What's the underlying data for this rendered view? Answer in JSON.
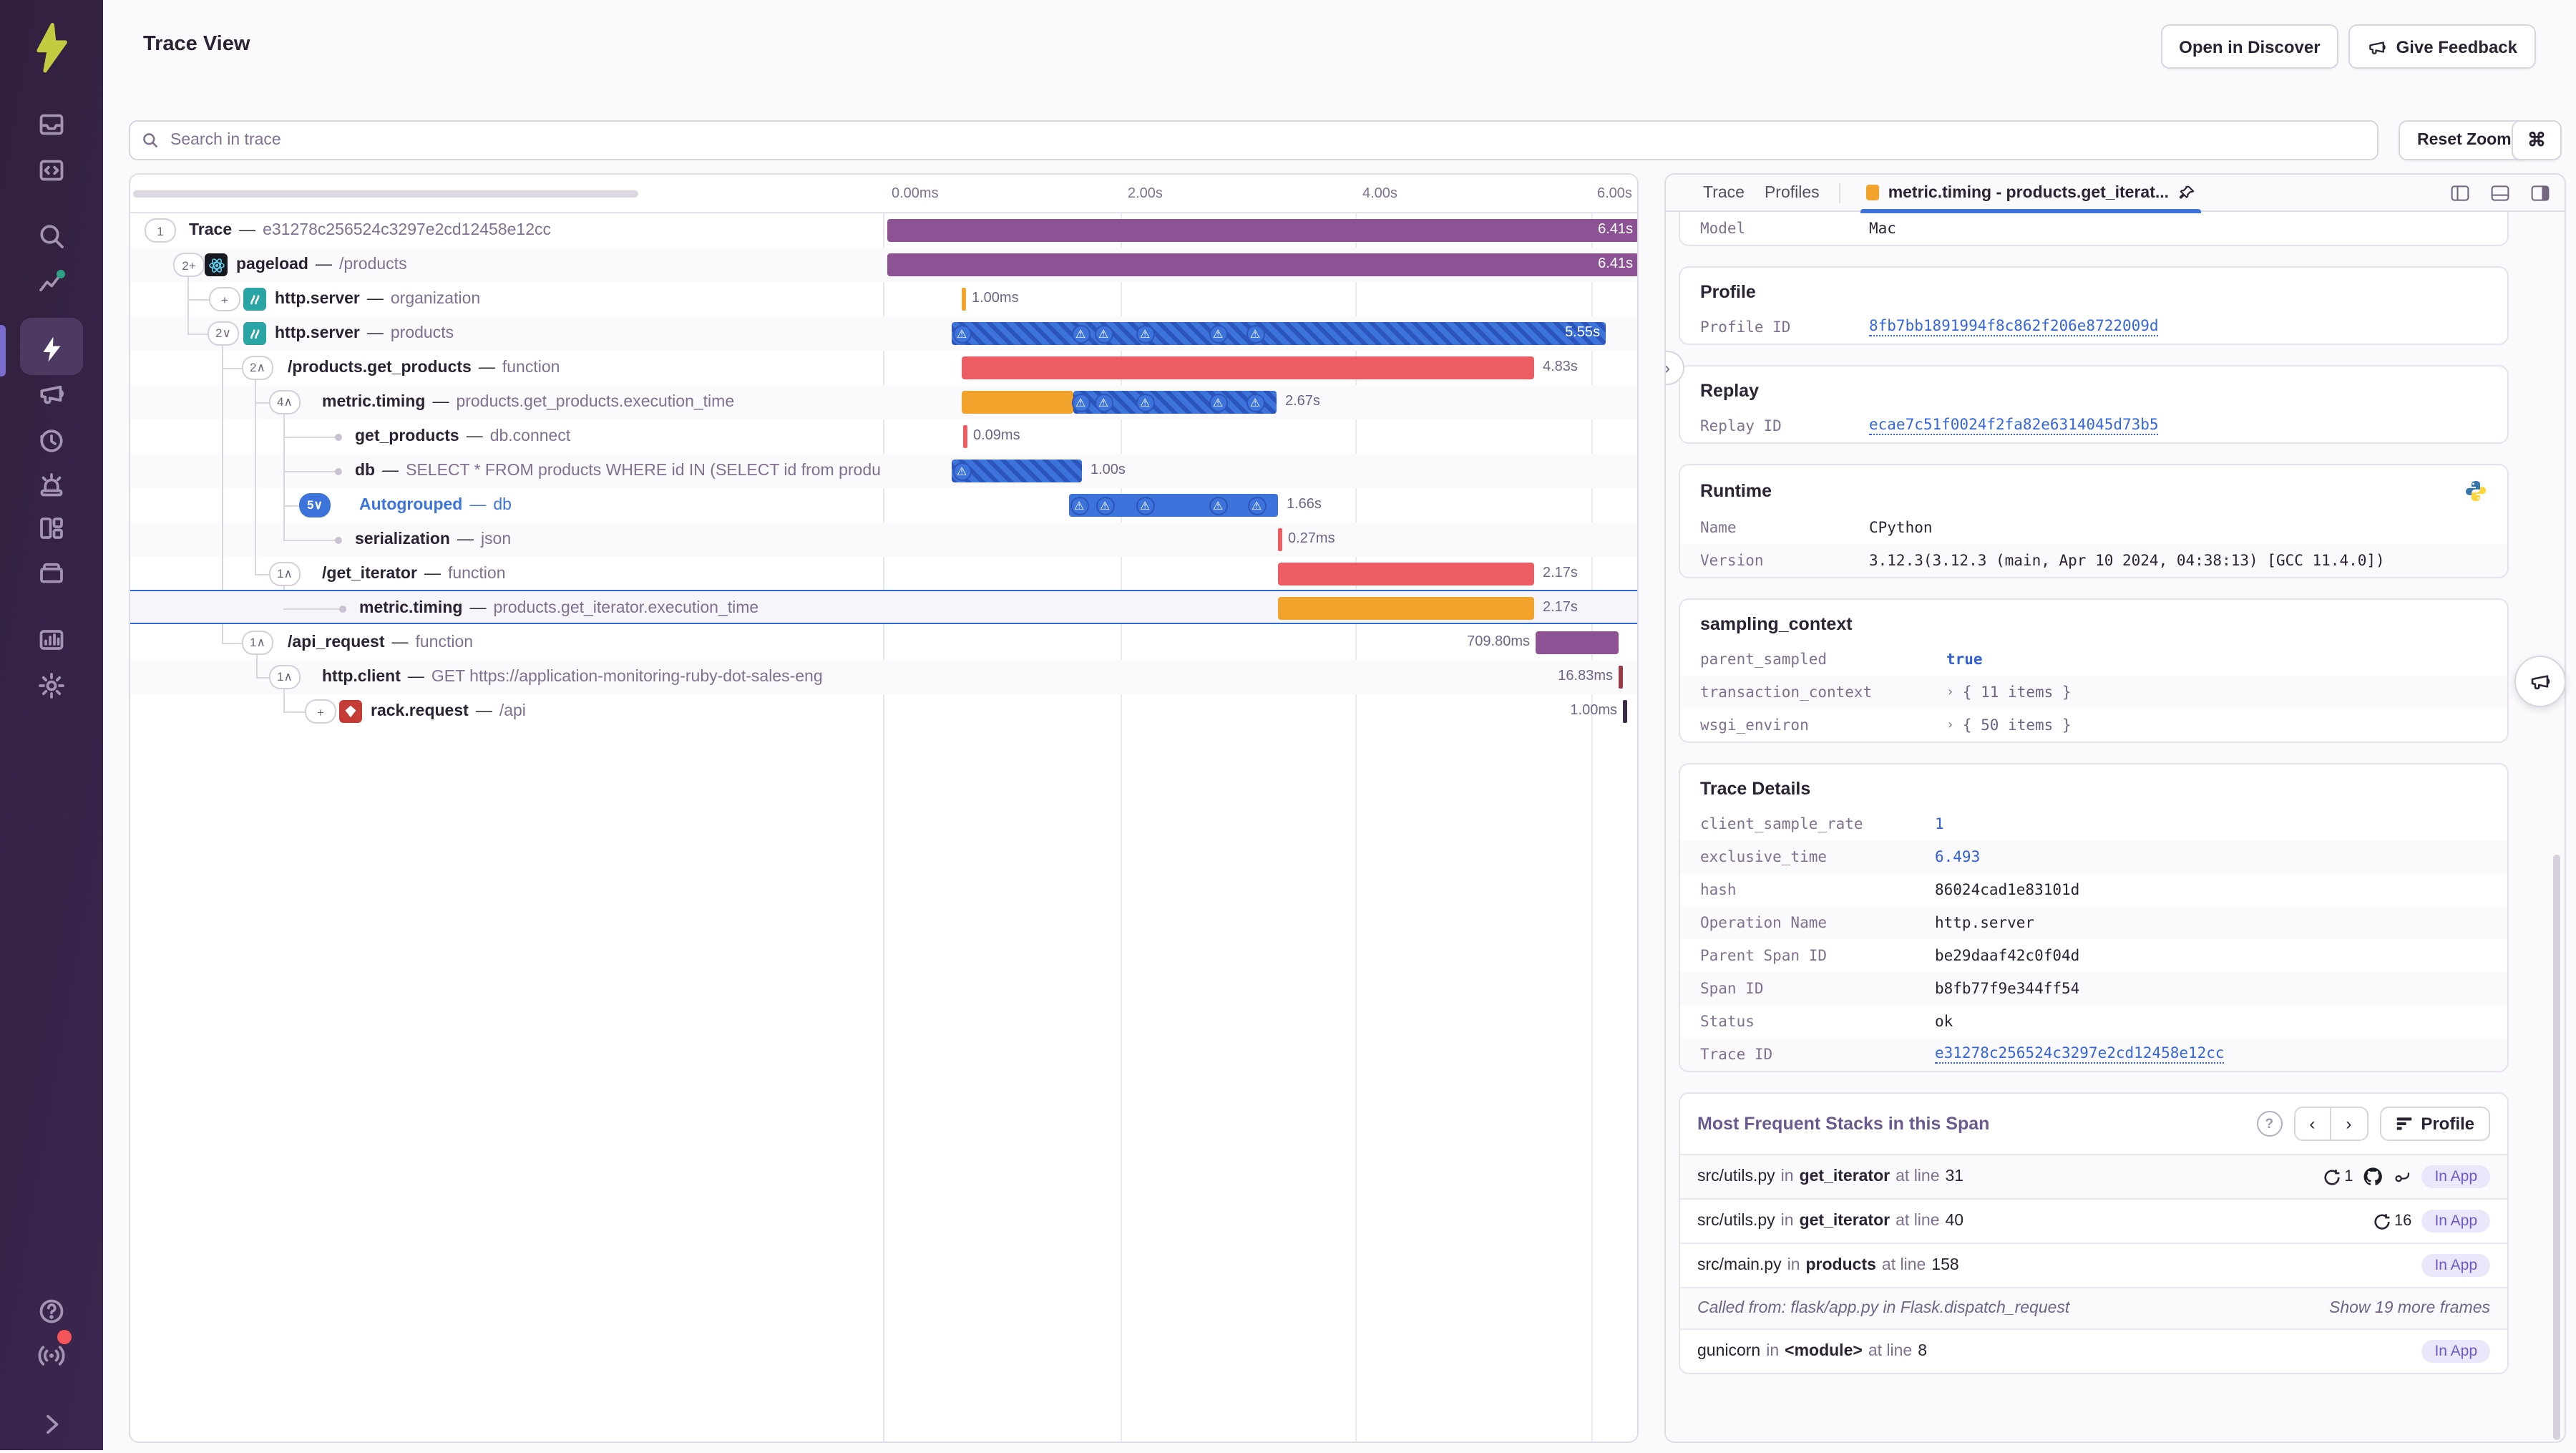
{
  "header": {
    "title": "Trace View",
    "open_in_discover": "Open in Discover",
    "give_feedback": "Give Feedback"
  },
  "toolbar": {
    "search_placeholder": "Search in trace",
    "reset_zoom": "Reset Zoom",
    "shortcut": "⌘"
  },
  "sidebar": {
    "items": [
      "issues-icon",
      "projects-icon",
      "search-icon",
      "performance-icon",
      "trace-icon",
      "megaphone-icon",
      "replays-icon",
      "alerts-icon",
      "dashboards-icon",
      "archive-icon",
      "stats-icon",
      "settings-icon"
    ],
    "active_item": "trace-icon",
    "bottom_items": [
      "help-icon",
      "whats-new-icon",
      "collapse-sidebar-icon"
    ]
  },
  "timeline": {
    "ticks": [
      "0.00ms",
      "2.00s",
      "4.00s",
      "6.00s"
    ]
  },
  "trace_tree": {
    "rows": [
      {
        "pill": "1",
        "title": "Trace",
        "desc": "e31278c256524c3297e2cd12458e12cc",
        "duration": "6.41s",
        "color": "purple"
      },
      {
        "pill": "2+",
        "icon": "react-icon",
        "title": "pageload",
        "desc": "/products",
        "duration": "6.41s",
        "color": "purple",
        "shade": true
      },
      {
        "pill": "+",
        "icon": "flask-icon",
        "title": "http.server",
        "desc": "organization",
        "duration": "1.00ms",
        "color": "orange"
      },
      {
        "pill": "2∨",
        "icon": "flask-icon",
        "title": "http.server",
        "desc": "products",
        "duration": "5.55s",
        "color": "blue-hatch",
        "shade": true,
        "warnings": 6
      },
      {
        "pill": "2∧",
        "title": "/products.get_products",
        "desc": "function",
        "duration": "4.83s",
        "color": "red"
      },
      {
        "pill": "4∧",
        "title": "metric.timing",
        "desc": "products.get_products.execution_time",
        "duration": "2.67s",
        "color": "orange-blue-hatch",
        "shade": true,
        "warnings": 5
      },
      {
        "title": "get_products",
        "desc": "db.connect",
        "duration": "0.09ms",
        "color": "red"
      },
      {
        "title": "db",
        "desc": "SELECT * FROM products WHERE id IN (SELECT id from produ",
        "duration": "1.00s",
        "color": "blue-hatch",
        "shade": true,
        "warnings": 1
      },
      {
        "pill": "5∨",
        "pill_variant": "blue",
        "title": "Autogrouped",
        "desc": "db",
        "title_variant": "blue",
        "duration": "1.66s",
        "color": "blue",
        "warnings": 5
      },
      {
        "title": "serialization",
        "desc": "json",
        "duration": "0.27ms",
        "color": "red",
        "shade": true
      },
      {
        "pill": "1∧",
        "title": "/get_iterator",
        "desc": "function",
        "duration": "2.17s",
        "color": "red"
      },
      {
        "title": "metric.timing",
        "desc": "products.get_iterator.execution_time",
        "duration": "2.17s",
        "color": "orange",
        "selected": true
      },
      {
        "pill": "1∧",
        "title": "/api_request",
        "desc": "function",
        "duration": "709.80ms",
        "color": "purple"
      },
      {
        "pill": "1∧",
        "title": "http.client",
        "desc": "GET https://application-monitoring-ruby-dot-sales-eng",
        "duration": "16.83ms",
        "color": "dark-red",
        "shade": true
      },
      {
        "pill": "+",
        "icon": "ruby-icon",
        "title": "rack.request",
        "desc": "/api",
        "duration": "1.00ms",
        "color": "dark-purple"
      }
    ]
  },
  "details": {
    "tabs": [
      {
        "label": "Trace"
      },
      {
        "label": "Profiles"
      }
    ],
    "active_tab": {
      "label": "metric.timing - products.get_iterat...",
      "swatch_color": "#F2A32C",
      "pin_icon": "pin-icon"
    },
    "layout_icons": [
      "panel-left-icon",
      "panel-bottom-icon",
      "panel-right-icon"
    ],
    "cards": [
      {
        "id": "device",
        "partial": true,
        "rows": [
          {
            "key": "Model",
            "value": "Mac"
          }
        ]
      },
      {
        "id": "profile",
        "title": "Profile",
        "rows": [
          {
            "key": "Profile ID",
            "value": "8fb7bb1891994f8c862f206e8722009d",
            "type": "link"
          }
        ]
      },
      {
        "id": "replay",
        "title": "Replay",
        "rows": [
          {
            "key": "Replay ID",
            "value": "ecae7c51f0024f2fa82e6314045d73b5",
            "type": "link"
          }
        ]
      },
      {
        "id": "runtime",
        "title": "Runtime",
        "icon": "python-icon",
        "rows": [
          {
            "key": "Name",
            "value": "CPython"
          },
          {
            "key": "Version",
            "value": "3.12.3(3.12.3 (main, Apr 10 2024, 04:38:13) [GCC 11.4.0])",
            "shade": true
          }
        ]
      },
      {
        "id": "sampling_context",
        "title": "sampling_context",
        "rows": [
          {
            "key": "parent_sampled",
            "value": "true",
            "type": "bool"
          },
          {
            "key": "transaction_context",
            "value": "{ 11 items }",
            "type": "expandable",
            "shade": true
          },
          {
            "key": "wsgi_environ",
            "value": "{ 50 items }",
            "type": "expandable"
          }
        ]
      },
      {
        "id": "trace_details",
        "title": "Trace Details",
        "rows": [
          {
            "key": "client_sample_rate",
            "value": "1",
            "type": "num"
          },
          {
            "key": "exclusive_time",
            "value": "6.493",
            "type": "num",
            "shade": true
          },
          {
            "key": "hash",
            "value": "86024cad1e83101d"
          },
          {
            "key": "Operation Name",
            "value": "http.server",
            "shade": true
          },
          {
            "key": "Parent Span ID",
            "value": "be29daaf42c0f04d"
          },
          {
            "key": "Span ID",
            "value": "b8fb77f9e344ff54",
            "shade": true
          },
          {
            "key": "Status",
            "value": "ok"
          },
          {
            "key": "Trace ID",
            "value": "e31278c256524c3297e2cd12458e12cc",
            "type": "link",
            "shade": true
          }
        ]
      }
    ],
    "stacks": {
      "title": "Most Frequent Stacks in this Span",
      "profile_button": "Profile",
      "in_app_label": "In App",
      "rows": [
        {
          "file": "src/utils.py",
          "in": "in",
          "func": "get_iterator",
          "at": "at line",
          "line": "31",
          "repeat": "1",
          "github": true,
          "commit": true,
          "in_app": true,
          "shade": true
        },
        {
          "file": "src/utils.py",
          "in": "in",
          "func": "get_iterator",
          "at": "at line",
          "line": "40",
          "repeat": "16",
          "in_app": true
        },
        {
          "file": "src/main.py",
          "in": "in",
          "func": "products",
          "at": "at line",
          "line": "158",
          "in_app": true
        },
        {
          "called_from": "Called from: flask/app.py in Flask.dispatch_request",
          "more": "Show 19 more frames",
          "shade": true
        },
        {
          "file": "gunicorn",
          "in": "in",
          "func": "<module>",
          "at": "at line",
          "line": "8",
          "in_app": true
        }
      ]
    }
  }
}
